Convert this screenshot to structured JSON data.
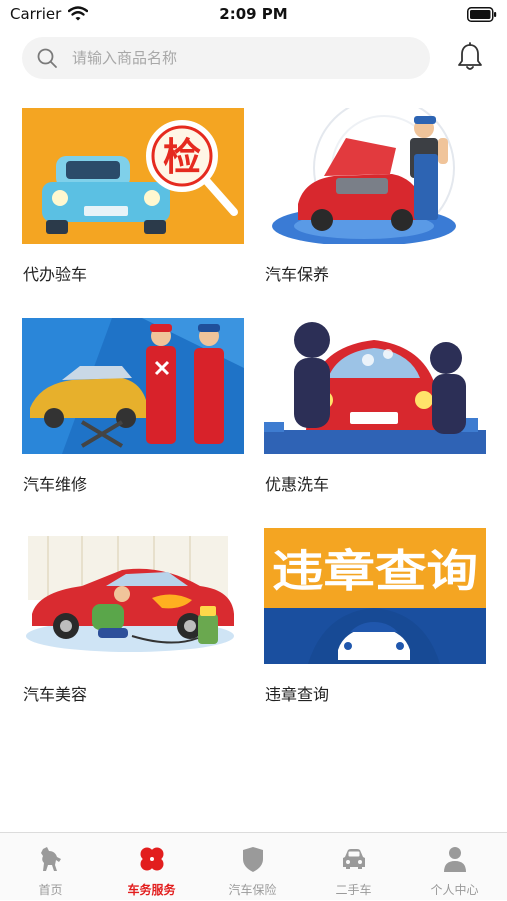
{
  "status_bar": {
    "carrier": "Carrier",
    "time": "2:09 PM"
  },
  "search": {
    "placeholder": "请输入商品名称"
  },
  "services": [
    {
      "label": "代办验车",
      "image_text": "检"
    },
    {
      "label": "汽车保养"
    },
    {
      "label": "汽车维修"
    },
    {
      "label": "优惠洗车"
    },
    {
      "label": "汽车美容"
    },
    {
      "label": "违章查询",
      "image_text": "违章查询"
    }
  ],
  "tabbar": {
    "items": [
      {
        "label": "首页",
        "icon": "horse-icon"
      },
      {
        "label": "车务服务",
        "icon": "clover-icon",
        "active": true
      },
      {
        "label": "汽车保险",
        "icon": "shield-icon"
      },
      {
        "label": "二手车",
        "icon": "car-icon"
      },
      {
        "label": "个人中心",
        "icon": "person-icon"
      }
    ]
  },
  "colors": {
    "accent": "#e21e1e",
    "inactive": "#9a9a9a",
    "search_bg": "#f3f3f3"
  }
}
